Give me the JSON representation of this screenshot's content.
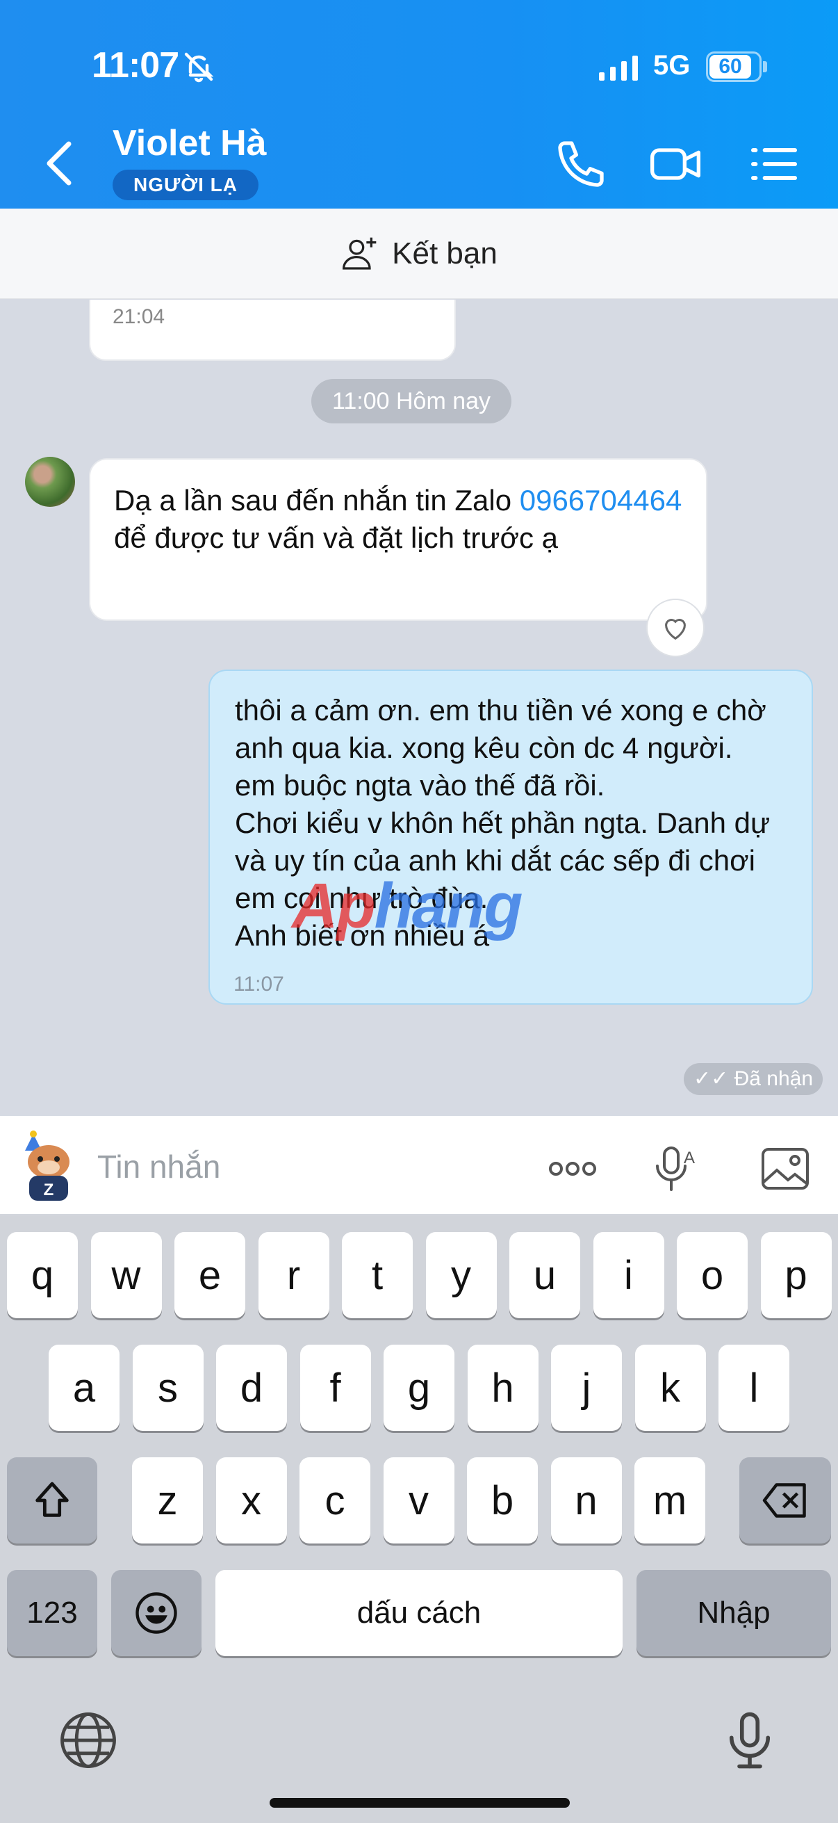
{
  "status_bar": {
    "time": "11:07",
    "network": "5G",
    "battery": "60"
  },
  "header": {
    "contact_name": "Violet Hà",
    "badge": "NGƯỜI LẠ"
  },
  "add_friend": {
    "label": "Kết bạn"
  },
  "chat": {
    "previous_time": "21:04",
    "date_separator": "11:00 Hôm nay",
    "incoming": {
      "text_before": "Dạ a lần sau đến nhắn tin Zalo ",
      "phone": "0966704464",
      "text_after": " để được tư vấn và đặt lịch trước ạ"
    },
    "outgoing": {
      "text": "thôi a cảm ơn. em thu tiền vé xong e chờ anh qua kia. xong kêu còn dc 4 người.\nem buộc ngta vào thế đã rồi.\nChơi kiểu v khôn hết phần ngta. Danh dự và uy tín của anh khi dắt các sếp đi chơi em coi như trò đùa.\nAnh biết ơn nhiều á",
      "time": "11:07"
    },
    "delivery_status": "✓✓ Đã nhận",
    "watermark": {
      "part1": "Ap",
      "part2": "hang"
    }
  },
  "input": {
    "placeholder": "Tin nhắn"
  },
  "keyboard": {
    "row1": [
      "q",
      "w",
      "e",
      "r",
      "t",
      "y",
      "u",
      "i",
      "o",
      "p"
    ],
    "row2": [
      "a",
      "s",
      "d",
      "f",
      "g",
      "h",
      "j",
      "k",
      "l"
    ],
    "row3": [
      "z",
      "x",
      "c",
      "v",
      "b",
      "n",
      "m"
    ],
    "numbers_key": "123",
    "space_key": "dấu cách",
    "return_key": "Nhập"
  }
}
